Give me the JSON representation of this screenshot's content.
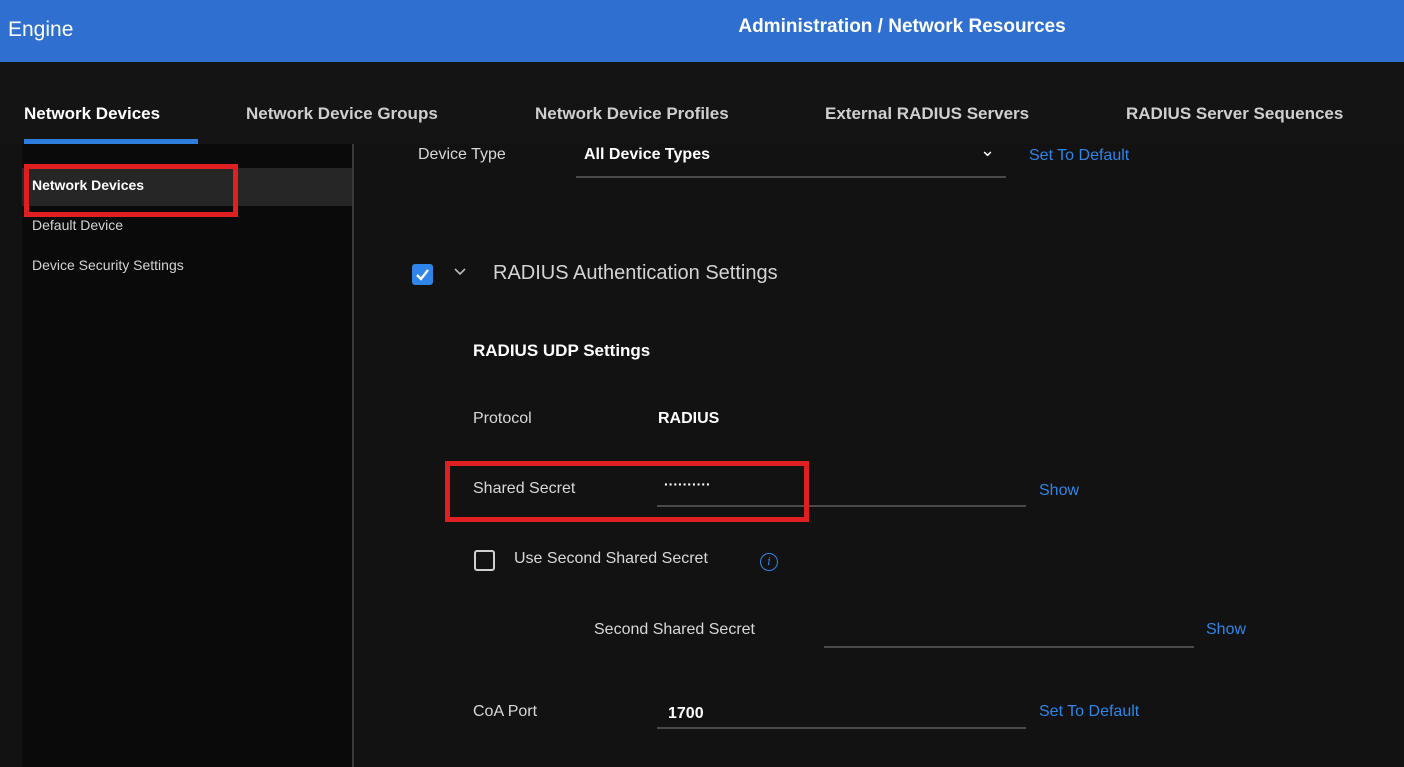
{
  "header": {
    "app_name": "Engine",
    "page_title": "Administration / Network Resources",
    "bar_color": "#2e6fd0"
  },
  "tabs": [
    {
      "label": "Network Devices",
      "active": true
    },
    {
      "label": "Network Device Groups",
      "active": false
    },
    {
      "label": "Network Device Profiles",
      "active": false
    },
    {
      "label": "External RADIUS Servers",
      "active": false
    },
    {
      "label": "RADIUS Server Sequences",
      "active": false
    }
  ],
  "sidebar": {
    "items": [
      {
        "label": "Network Devices",
        "active": true
      },
      {
        "label": "Default Device",
        "active": false
      },
      {
        "label": "Device Security Settings",
        "active": false
      }
    ]
  },
  "form": {
    "device_type": {
      "label": "Device Type",
      "value": "All Device Types",
      "reset_link": "Set To Default"
    },
    "radius_section": {
      "title": "RADIUS Authentication Settings",
      "enabled": true,
      "udp_title": "RADIUS UDP Settings",
      "protocol_label": "Protocol",
      "protocol_value": "RADIUS",
      "shared_secret": {
        "label": "Shared Secret",
        "value": "··········",
        "show_link": "Show"
      },
      "use_second_secret": {
        "label": "Use Second Shared Secret",
        "checked": false,
        "info_icon": "info-icon"
      },
      "second_secret": {
        "label": "Second Shared Secret",
        "value": "",
        "show_link": "Show"
      },
      "coa_port": {
        "label": "CoA Port",
        "value": "1700",
        "reset_link": "Set To Default"
      }
    }
  },
  "annotation_color": "#e02020",
  "link_color": "#2f86e8"
}
